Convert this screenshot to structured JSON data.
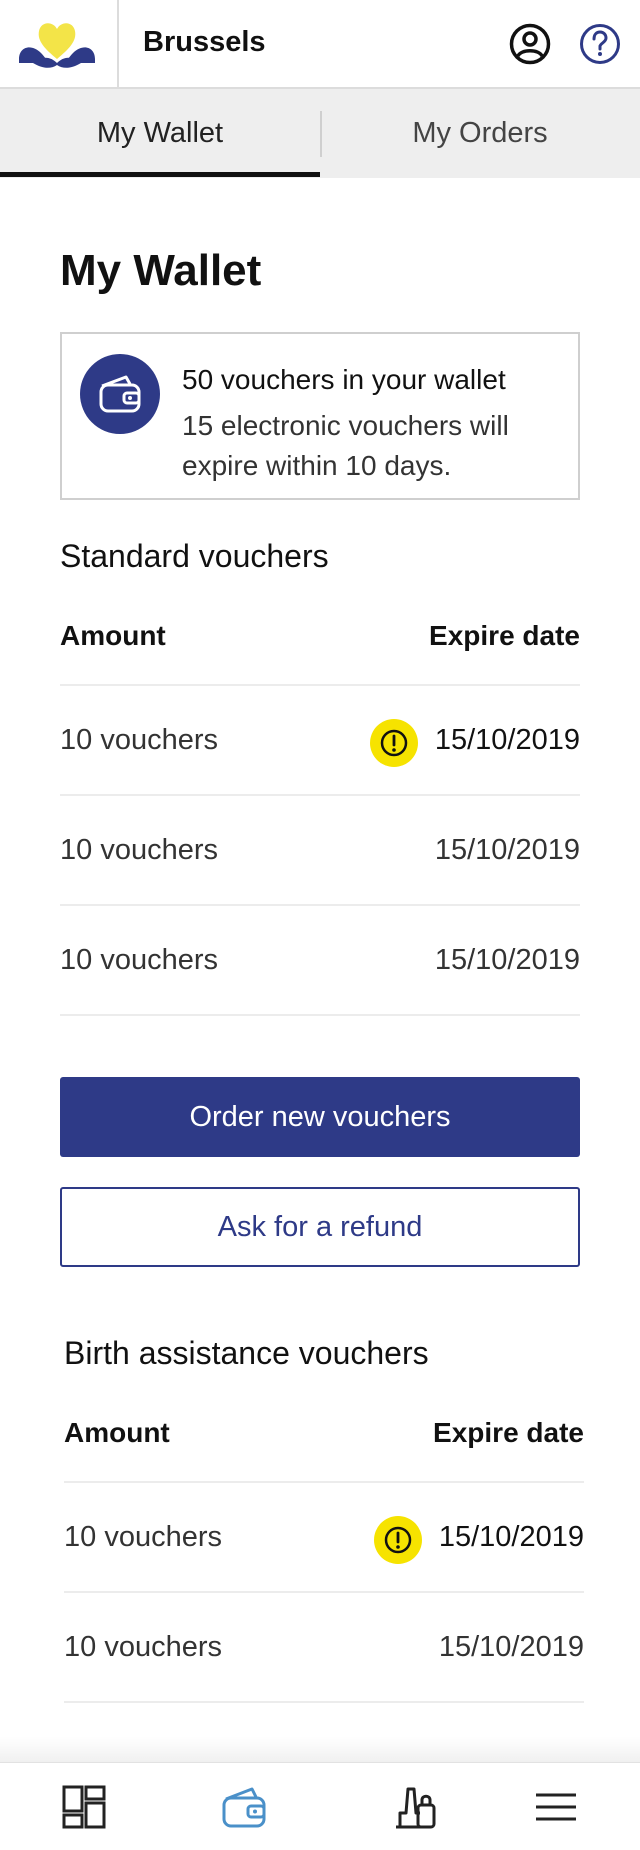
{
  "header": {
    "city": "Brussels",
    "logo_icon": "brussels-iris-logo",
    "user_icon": "user-icon",
    "help_icon": "help-icon"
  },
  "tabs": [
    {
      "label": "My Wallet",
      "active": true
    },
    {
      "label": "My Orders",
      "active": false
    }
  ],
  "main": {
    "title": "My Wallet",
    "summary": {
      "icon": "wallet-icon",
      "title": "50 vouchers in your wallet",
      "subtitle": "15 electronic vouchers will expire within 10 days."
    },
    "standard": {
      "title": "Standard vouchers",
      "col_amount": "Amount",
      "col_expire": "Expire date",
      "rows": [
        {
          "amount": "10 vouchers",
          "date": "15/10/2019",
          "warning": true
        },
        {
          "amount": "10 vouchers",
          "date": "15/10/2019",
          "warning": false
        },
        {
          "amount": "10 vouchers",
          "date": "15/10/2019",
          "warning": false
        }
      ]
    },
    "buttons": {
      "order": "Order new vouchers",
      "refund": "Ask for a refund"
    },
    "birth": {
      "title": "Birth assistance vouchers",
      "col_amount": "Amount",
      "col_expire": "Expire date",
      "rows": [
        {
          "amount": "10 vouchers",
          "date": "15/10/2019",
          "warning": true
        },
        {
          "amount": "10 vouchers",
          "date": "15/10/2019",
          "warning": false
        }
      ]
    }
  },
  "bottom_nav": [
    {
      "icon": "dashboard-icon",
      "active": false
    },
    {
      "icon": "wallet-icon",
      "active": true
    },
    {
      "icon": "shopping-icon",
      "active": false
    },
    {
      "icon": "menu-icon",
      "active": false
    }
  ],
  "colors": {
    "brand_blue": "#2e3a87",
    "warning_yellow": "#f6e300",
    "active_nav": "#4a90c9"
  }
}
